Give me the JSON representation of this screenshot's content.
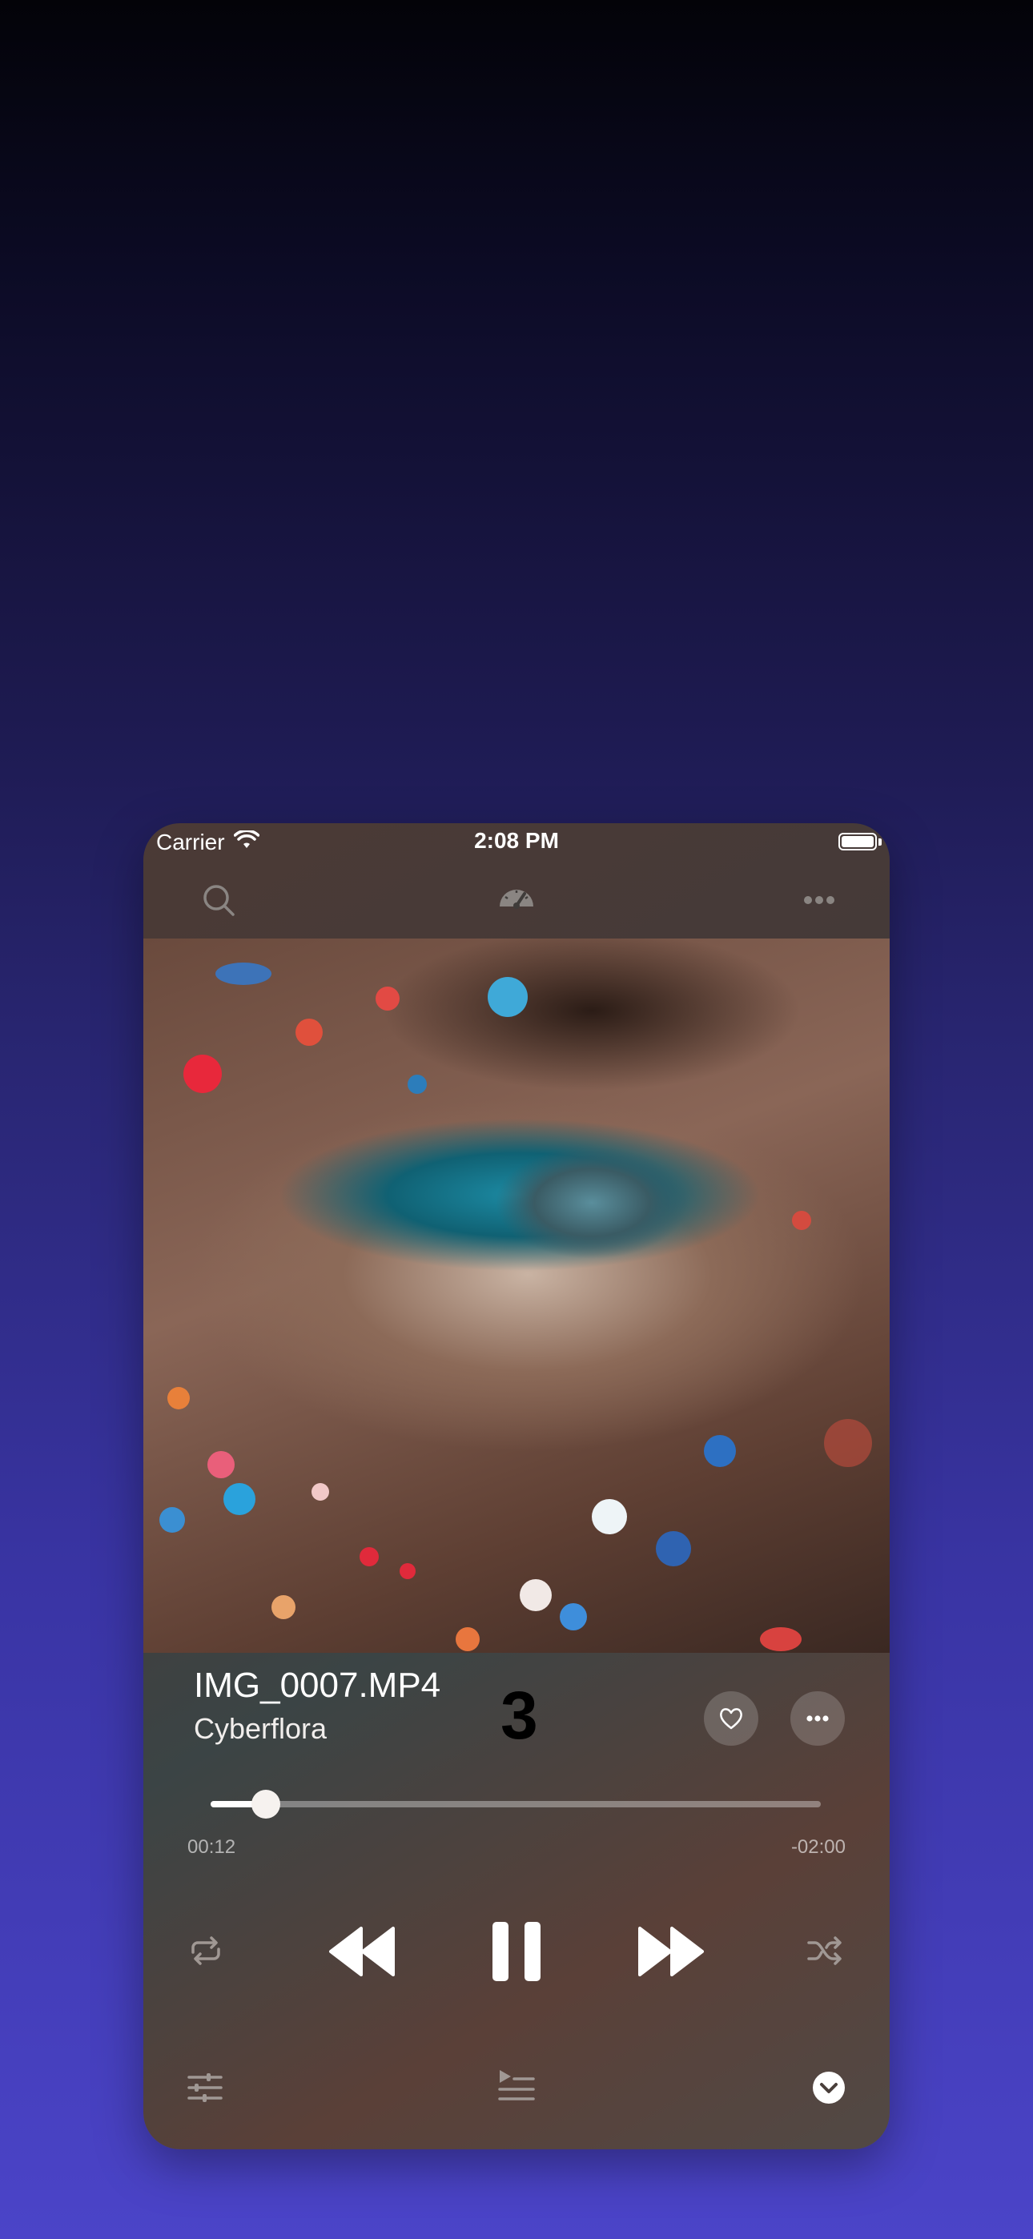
{
  "status_bar": {
    "carrier": "Carrier",
    "time": "2:08 PM"
  },
  "top_bar": {
    "icons": [
      "search-icon",
      "speedometer-icon",
      "more-horizontal-icon"
    ]
  },
  "track": {
    "title": "IMG_0007.MP4",
    "artist": "Cyberflora",
    "overlay_number": "3"
  },
  "playback": {
    "elapsed": "00:12",
    "remaining": "-02:00",
    "progress": 0.09,
    "state": "playing"
  },
  "controls": [
    "repeat-icon",
    "rewind-icon",
    "pause-icon",
    "fast-forward-icon",
    "shuffle-icon"
  ],
  "bottom_bar": [
    "equalizer-icon",
    "queue-icon",
    "collapse-icon"
  ],
  "colors": {
    "bg_top": "#030308",
    "bg_bottom": "#4b44c8",
    "text": "#ffffff",
    "muted_icon": "#a09894"
  }
}
